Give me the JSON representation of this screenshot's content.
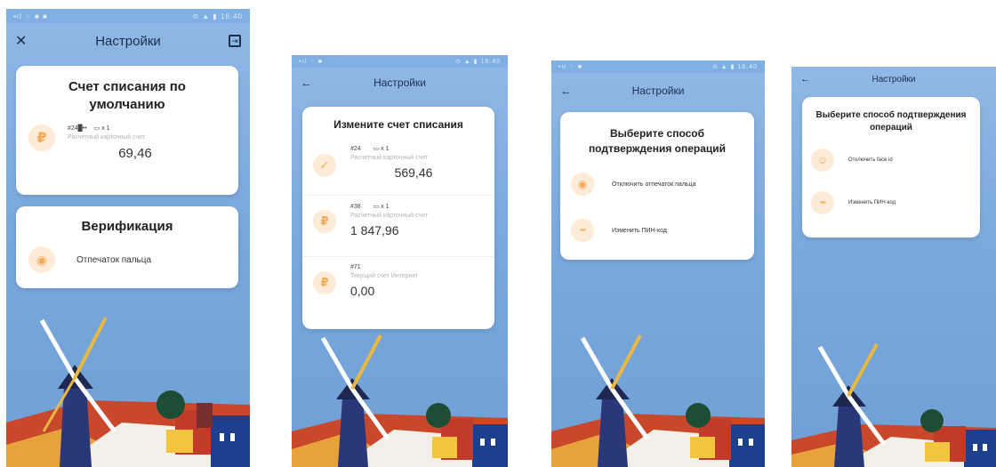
{
  "colors": {
    "sky": "#7aa9dc",
    "accent": "#f3a955",
    "accent_bg": "#fdebd8",
    "text": "#222222"
  },
  "screen1": {
    "status_left": "•ıl ⁘ ■ ■",
    "status_right": "⊙ ▲ ▮ 16:40",
    "title": "Настройки",
    "close_icon": "close-icon",
    "exit_icon": "exit-icon",
    "default_card": {
      "title": "Счет списания по умолчанию",
      "account_num": "#24█••",
      "cards_count": "x 1",
      "account_type": "Расчетный карточный счет",
      "amount": "69,46"
    },
    "verification_card": {
      "title": "Верификация",
      "option": "Отпечаток пальца"
    }
  },
  "screen2": {
    "status_left": "•ıl ⁘ ■",
    "status_right": "⊙ ▲ ▮ 16:40",
    "title": "Настройки",
    "card_title": "Измените счет списания",
    "accounts": [
      {
        "num": "#24",
        "cards": "x 1",
        "type": "Расчетный карточный счет",
        "amount": "569,46",
        "selected": true
      },
      {
        "num": "#38",
        "cards": "x 1",
        "type": "Расчетный карточный счет",
        "amount": "1 847,96",
        "selected": false
      },
      {
        "num": "#71",
        "cards": "",
        "type": "Текущий счет Интернет",
        "amount": "0,00",
        "selected": false
      }
    ]
  },
  "screen3": {
    "status_left": "•ıl ⁘ ■",
    "status_right": "⊙ ▲ ▮ 16:40",
    "title": "Настройки",
    "card_title": "Выберите способ подтверждения операций",
    "options": [
      "Отключить отпечаток пальца",
      "Изменить ПИН-код"
    ]
  },
  "screen4": {
    "title": "Настройки",
    "card_title": "Выберите способ подтверждения операций",
    "options": [
      "Отключить face id",
      "Изменить ПИН-код"
    ]
  }
}
